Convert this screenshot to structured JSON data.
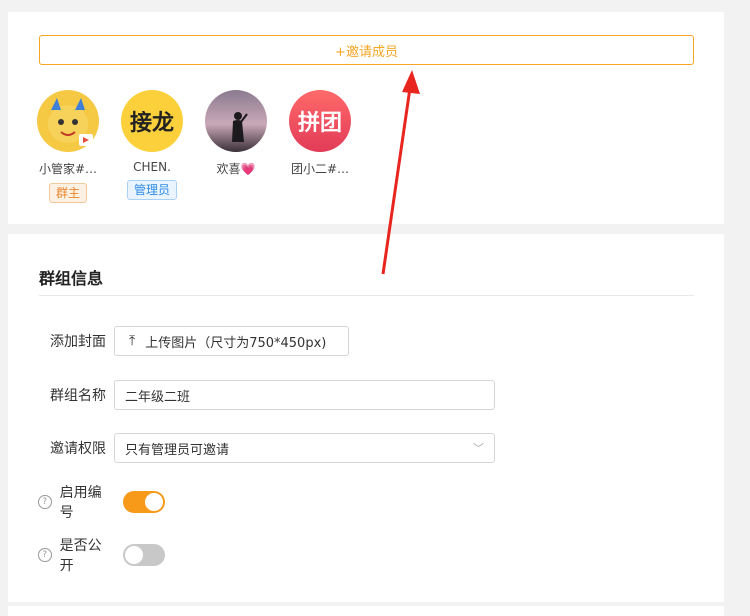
{
  "members_panel": {
    "invite_label": "+邀请成员",
    "members": [
      {
        "name": "小管家#…",
        "badge": "群主",
        "avatar_kind": "mascot"
      },
      {
        "name": "CHEN.",
        "badge": "管理员",
        "avatar_kind": "text",
        "avatar_text": "接龙"
      },
      {
        "name": "欢喜💗",
        "badge": "",
        "avatar_kind": "photo"
      },
      {
        "name": "团小二#…",
        "badge": "",
        "avatar_kind": "text",
        "avatar_text": "拼团"
      }
    ]
  },
  "group_info": {
    "title": "群组信息",
    "cover": {
      "label": "添加封面",
      "upload_text": "上传图片（尺寸为750*450px)",
      "icon": "upload-icon"
    },
    "name": {
      "label": "群组名称",
      "value": "二年级二班"
    },
    "invite_permission": {
      "label": "邀请权限",
      "value": "只有管理员可邀请",
      "icon": "chevron-down-icon"
    },
    "numbering": {
      "label": "启用编号",
      "enabled": true,
      "icon": "help-icon"
    },
    "public": {
      "label": "是否公开",
      "enabled": false,
      "icon": "help-icon"
    }
  },
  "colors": {
    "accent": "#f5a623",
    "toggle_on": "#f79a1a",
    "toggle_off": "#c8c8c8",
    "annotation_arrow": "#e8251f"
  }
}
